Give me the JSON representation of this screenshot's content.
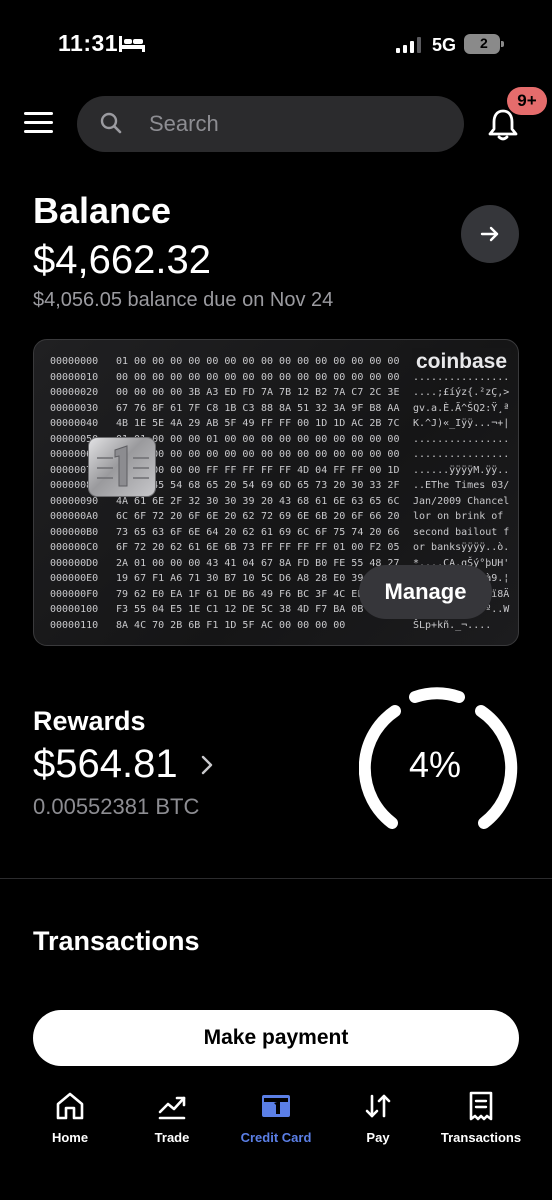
{
  "status_bar": {
    "time": "11:31",
    "network": "5G",
    "battery_level": "2"
  },
  "header": {
    "search_placeholder": "Search",
    "notification_badge": "9+"
  },
  "balance": {
    "title": "Balance",
    "amount": "$4,662.32",
    "due_text": "$4,056.05 balance due on Nov 24"
  },
  "card": {
    "brand": "coinbase",
    "manage_label": "Manage",
    "hex_rows": [
      {
        "offset": "00000000",
        "bytes1": "01 00 00 00 00 00 00 00",
        "bytes2": "00 00 00 00 00 00 00 00",
        "ascii": "................"
      },
      {
        "offset": "00000010",
        "bytes1": "00 00 00 00 00 00 00 00",
        "bytes2": "00 00 00 00 00 00 00 00",
        "ascii": "................"
      },
      {
        "offset": "00000020",
        "bytes1": "00 00 00 00 3B A3 ED FD",
        "bytes2": "7A 7B 12 B2 7A C7 2C 3E",
        "ascii": "....;£íýz{.²zÇ,>"
      },
      {
        "offset": "00000030",
        "bytes1": "67 76 8F 61 7F C8 1B C3",
        "bytes2": "88 8A 51 32 3A 9F B8 AA",
        "ascii": "gv.a.È.Ã^ŠQ2:Ÿ¸ª"
      },
      {
        "offset": "00000040",
        "bytes1": "4B 1E 5E 4A 29 AB 5F 49",
        "bytes2": "FF FF 00 1D 1D AC 2B 7C",
        "ascii": "K.^J)«_Iÿÿ...¬+|"
      },
      {
        "offset": "00000050",
        "bytes1": "01 01 00 00 00 01 00 00",
        "bytes2": "00 00 00 00 00 00 00 00",
        "ascii": "................"
      },
      {
        "offset": "00000060",
        "bytes1": "00 00 00 00 00 00 00 00",
        "bytes2": "00 00 00 00 00 00 00 00",
        "ascii": "................"
      },
      {
        "offset": "00000070",
        "bytes1": "00 00 00 00 00 FF FF FF",
        "bytes2": "FF FF 4D 04 FF FF 00 1D",
        "ascii": "......ÿÿÿÿM.ÿÿ.."
      },
      {
        "offset": "00000080",
        "bytes1": "01 04 45 54 68 65 20 54",
        "bytes2": "69 6D 65 73 20 30 33 2F",
        "ascii": "..EThe Times 03/"
      },
      {
        "offset": "00000090",
        "bytes1": "4A 61 6E 2F 32 30 30 39",
        "bytes2": "20 43 68 61 6E 63 65 6C",
        "ascii": "Jan/2009 Chancel"
      },
      {
        "offset": "000000A0",
        "bytes1": "6C 6F 72 20 6F 6E 20 62",
        "bytes2": "72 69 6E 6B 20 6F 66 20",
        "ascii": "lor on brink of "
      },
      {
        "offset": "000000B0",
        "bytes1": "73 65 63 6F 6E 64 20 62",
        "bytes2": "61 69 6C 6F 75 74 20 66",
        "ascii": "second bailout f"
      },
      {
        "offset": "000000C0",
        "bytes1": "6F 72 20 62 61 6E 6B 73",
        "bytes2": "FF FF FF FF 01 00 F2 05",
        "ascii": "or banksÿÿÿÿ..ò."
      },
      {
        "offset": "000000D0",
        "bytes1": "2A 01 00 00 00 43 41 04",
        "bytes2": "67 8A FD B0 FE 55 48 27",
        "ascii": "*....CA.gŠý°þUH'"
      },
      {
        "offset": "000000E0",
        "bytes1": "19 67 F1 A6 71 30 B7 10",
        "bytes2": "5C D6 A8 28 E0 39 09 A6",
        "ascii": ".gñ¦q0·.\\Ö¨(à9.¦"
      },
      {
        "offset": "000000F0",
        "bytes1": "79 62 E0 EA 1F 61 DE B6",
        "bytes2": "49 F6 BC 3F 4C EF 38 C4",
        "ascii": "ybàê.aÞ¶Iö¼?Lï8Ä"
      },
      {
        "offset": "00000100",
        "bytes1": "F3 55 04 E5 1E C1 12 DE",
        "bytes2": "5C 38 4D F7 BA 0B 8D 57",
        "ascii": "óU.å.Á.Þ\\8M÷º..W"
      },
      {
        "offset": "00000110",
        "bytes1": "8A 4C 70 2B 6B F1 1D 5F",
        "bytes2": "AC 00 00 00 00",
        "ascii": "ŠLp+kñ._¬...."
      }
    ]
  },
  "rewards": {
    "title": "Rewards",
    "amount": "$564.81",
    "btc": "0.00552381 BTC",
    "percent_label": "4%"
  },
  "transactions": {
    "title": "Transactions"
  },
  "actions": {
    "pay_label": "Make payment"
  },
  "nav": {
    "items": [
      {
        "label": "Home",
        "icon": "home-icon"
      },
      {
        "label": "Trade",
        "icon": "trade-icon"
      },
      {
        "label": "Credit Card",
        "icon": "credit-card-icon",
        "active": true
      },
      {
        "label": "Pay",
        "icon": "pay-icon"
      },
      {
        "label": "Transactions",
        "icon": "transactions-icon"
      }
    ]
  },
  "colors": {
    "background": "#000000",
    "accent": "#5b7fe6",
    "badge": "#e56c6c",
    "surface": "#2b2b2d"
  }
}
